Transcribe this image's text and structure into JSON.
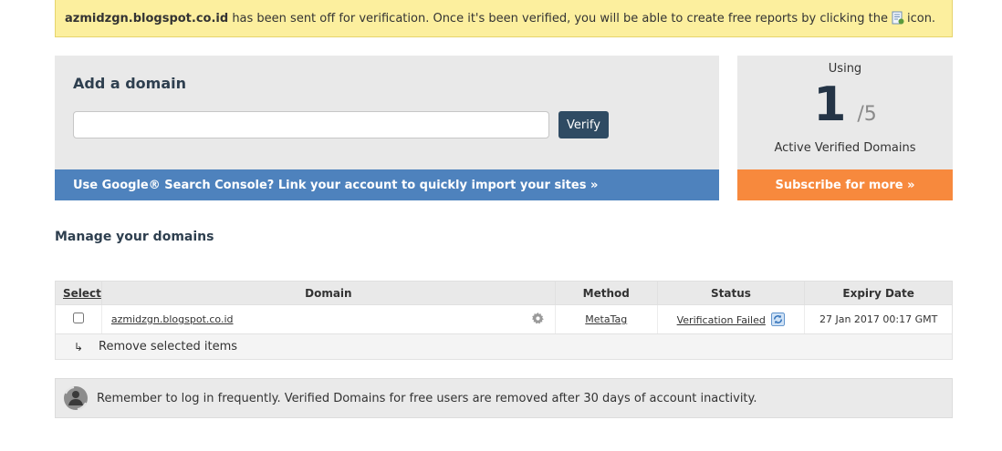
{
  "notice": {
    "domain": "azmidzgn.blogspot.co.id",
    "message_before_icon": " has been sent off for verification. Once it's been verified, you will be able to create free reports by clicking the",
    "message_after_icon": "icon.",
    "icon": "report-icon"
  },
  "add_domain": {
    "title": "Add a domain",
    "input_value": "",
    "input_placeholder": "",
    "verify_label": "Verify",
    "gsc_link": "Use Google® Search Console? Link your account to quickly import your sites »"
  },
  "usage": {
    "using_label": "Using",
    "used": "1",
    "total": "/5",
    "label": "Active Verified Domains",
    "subscribe_label": "Subscribe for more »"
  },
  "manage": {
    "title": "Manage your domains",
    "columns": [
      "Select",
      "Domain",
      "Method",
      "Status",
      "Expiry Date"
    ],
    "rows": [
      {
        "checked": false,
        "domain": "azmidzgn.blogspot.co.id",
        "method": "MetaTag",
        "status": "Verification Failed",
        "expiry": "27 Jan 2017 00:17 GMT"
      }
    ],
    "remove_arrow": "↳",
    "remove_label": "Remove selected items"
  },
  "reminder": {
    "text": "Remember to log in frequently. Verified Domains for free users are removed after 30 days of account inactivity.",
    "icon": "user-refresh-icon"
  },
  "colors": {
    "notice_bg": "#fcef9e",
    "panel_bg": "#e9e9e9",
    "verify_button": "#2f4b63",
    "gsc_bar": "#4e82bd",
    "subscribe_bar": "#f7893d",
    "heading": "#2e3f4f"
  }
}
